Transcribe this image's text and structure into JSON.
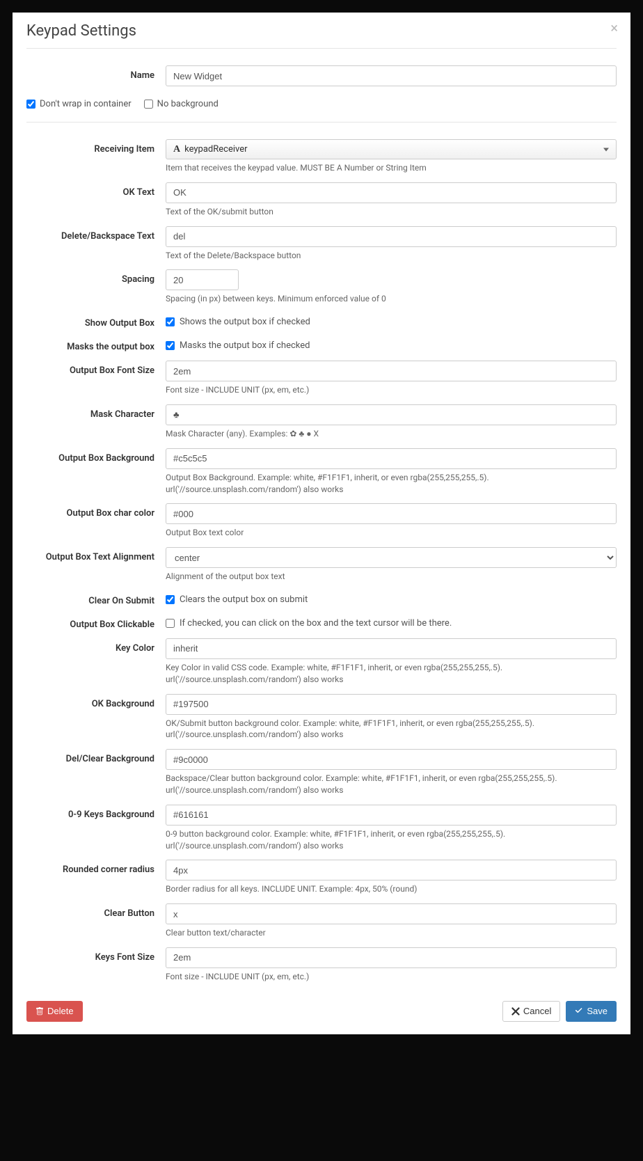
{
  "modal": {
    "title": "Keypad Settings"
  },
  "top": {
    "name_label": "Name",
    "name_value": "New Widget",
    "cb1": "Don't wrap in container",
    "cb2": "No background"
  },
  "fields": {
    "receiving_item": {
      "label": "Receiving Item",
      "value": "keypadReceiver",
      "help": "Item that receives the keypad value. MUST BE A Number or String Item"
    },
    "ok_text": {
      "label": "OK Text",
      "value": "OK",
      "help": "Text of the OK/submit button"
    },
    "del_text": {
      "label": "Delete/Backspace Text",
      "value": "del",
      "help": "Text of the Delete/Backspace button"
    },
    "spacing": {
      "label": "Spacing",
      "value": "20",
      "help": "Spacing (in px) between keys. Minimum enforced value of 0"
    },
    "show_output": {
      "label": "Show Output Box",
      "text": "Shows the output box if checked"
    },
    "mask_output": {
      "label": "Masks the output box",
      "text": "Masks the output box if checked"
    },
    "output_font_size": {
      "label": "Output Box Font Size",
      "value": "2em",
      "help": "Font size - INCLUDE UNIT (px, em, etc.)"
    },
    "mask_char": {
      "label": "Mask Character",
      "value": "♣",
      "help": "Mask Character (any). Examples: ✿ ♣ ● X"
    },
    "output_bg": {
      "label": "Output Box Background",
      "value": "#c5c5c5",
      "help": "Output Box Background. Example: white, #F1F1F1, inherit, or even rgba(255,255,255,.5). url('//source.unsplash.com/random') also works"
    },
    "output_color": {
      "label": "Output Box char color",
      "value": "#000",
      "help": "Output Box text color"
    },
    "output_align": {
      "label": "Output Box Text Alignment",
      "value": "center",
      "help": "Alignment of the output box text"
    },
    "clear_submit": {
      "label": "Clear On Submit",
      "text": "Clears the output box on submit"
    },
    "output_clickable": {
      "label": "Output Box Clickable",
      "text": "If checked, you can click on the box and the text cursor will be there."
    },
    "key_color": {
      "label": "Key Color",
      "value": "inherit",
      "help": "Key Color in valid CSS code. Example: white, #F1F1F1, inherit, or even rgba(255,255,255,.5). url('//source.unsplash.com/random') also works"
    },
    "ok_bg": {
      "label": "OK Background",
      "value": "#197500",
      "help": "OK/Submit button background color. Example: white, #F1F1F1, inherit, or even rgba(255,255,255,.5). url('//source.unsplash.com/random') also works"
    },
    "del_bg": {
      "label": "Del/Clear Background",
      "value": "#9c0000",
      "help": "Backspace/Clear button background color. Example: white, #F1F1F1, inherit, or even rgba(255,255,255,.5). url('//source.unsplash.com/random') also works"
    },
    "keys_bg": {
      "label": "0-9 Keys Background",
      "value": "#616161",
      "help": "0-9 button background color. Example: white, #F1F1F1, inherit, or even rgba(255,255,255,.5). url('//source.unsplash.com/random') also works"
    },
    "radius": {
      "label": "Rounded corner radius",
      "value": "4px",
      "help": "Border radius for all keys. INCLUDE UNIT. Example: 4px, 50% (round)"
    },
    "clear_btn": {
      "label": "Clear Button",
      "value": "x",
      "help": "Clear button text/character"
    },
    "keys_font_size": {
      "label": "Keys Font Size",
      "value": "2em",
      "help": "Font size - INCLUDE UNIT (px, em, etc.)"
    }
  },
  "footer": {
    "delete": "Delete",
    "cancel": "Cancel",
    "save": "Save"
  }
}
